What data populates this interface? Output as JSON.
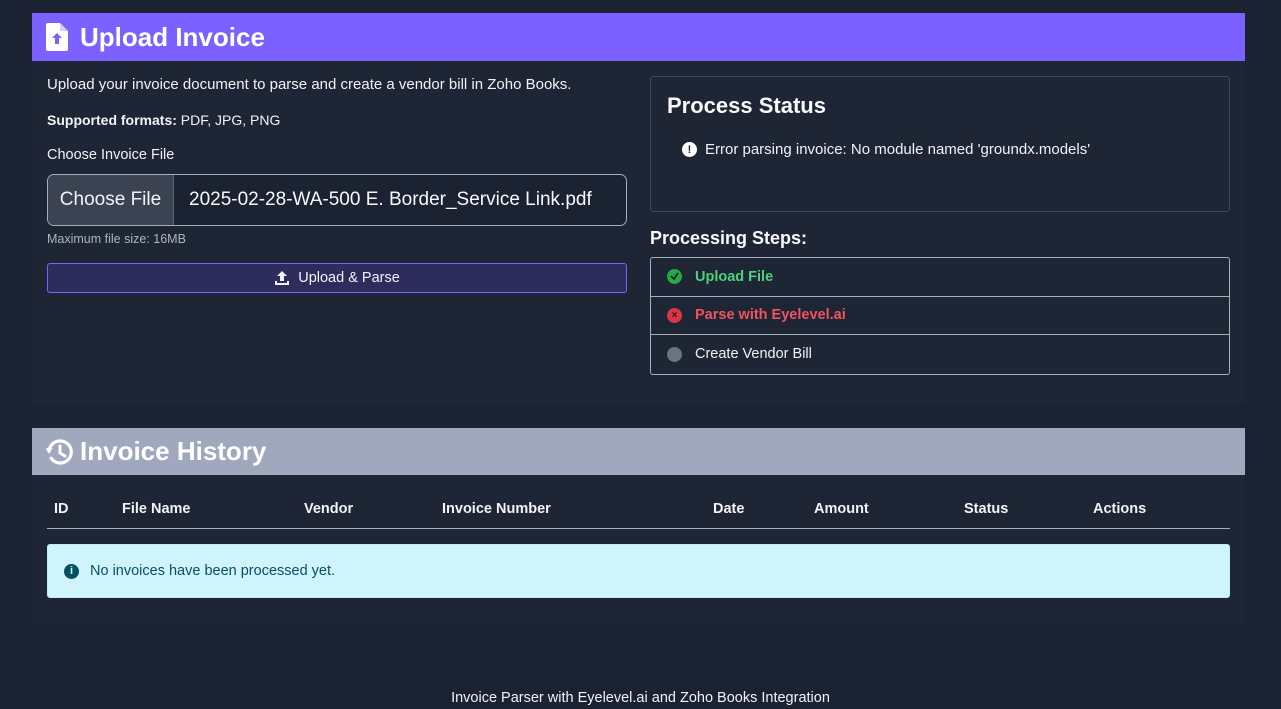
{
  "upload": {
    "header_title": "Upload Invoice",
    "description": "Upload your invoice document to parse and create a vendor bill in Zoho Books.",
    "formats_label": "Supported formats:",
    "formats_value": "PDF, JPG, PNG",
    "choose_label": "Choose Invoice File",
    "choose_button": "Choose File",
    "file_name": "2025-02-28-WA-500 E. Border_Service Link.pdf",
    "max_size": "Maximum file size: 16MB",
    "upload_button": "Upload & Parse",
    "accent_color": "#7b61ff"
  },
  "status": {
    "title": "Process Status",
    "message": "Error parsing invoice: No module named 'groundx.models'",
    "message_icon": "exclamation-circle-icon"
  },
  "steps": {
    "title": "Processing Steps:",
    "items": [
      {
        "label": "Upload File",
        "state": "done",
        "icon": "check-circle-icon",
        "color": "#28a745"
      },
      {
        "label": "Parse with Eyelevel.ai",
        "state": "error",
        "icon": "x-circle-icon",
        "color": "#dc3545"
      },
      {
        "label": "Create Vendor Bill",
        "state": "pending",
        "icon": "circle-icon",
        "color": "#6c757d"
      }
    ]
  },
  "history": {
    "header_title": "Invoice History",
    "columns": [
      "ID",
      "File Name",
      "Vendor",
      "Invoice Number",
      "Date",
      "Amount",
      "Status",
      "Actions"
    ],
    "empty_message": "No invoices have been processed yet.",
    "empty_icon": "info-circle-icon"
  },
  "footer": {
    "text": "Invoice Parser with Eyelevel.ai and Zoho Books Integration"
  }
}
